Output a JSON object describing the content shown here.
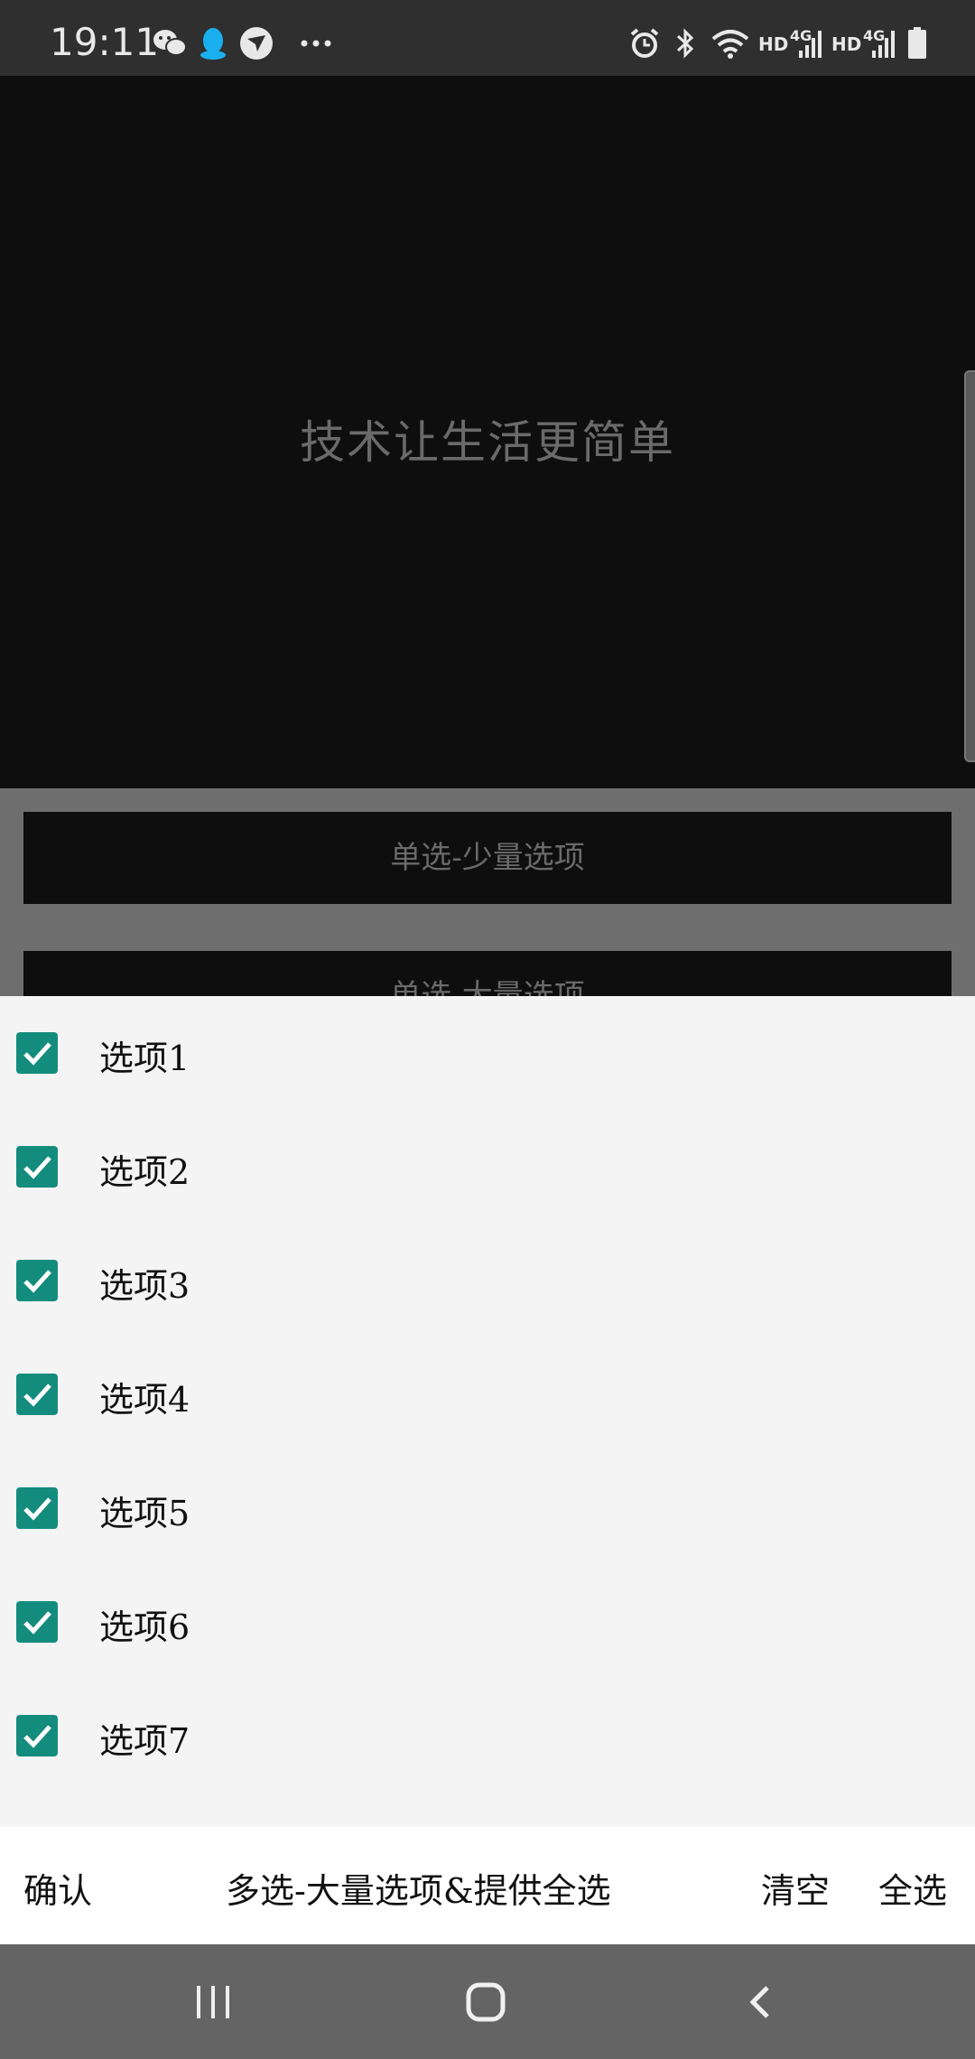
{
  "status_bar": {
    "time": "19:11",
    "icons_left": [
      "wechat-icon",
      "qq-icon",
      "app-icon",
      "more-icon"
    ],
    "icons_right": [
      "alarm-icon",
      "bluetooth-icon",
      "wifi-icon",
      "signal-icon",
      "signal-icon",
      "battery-icon"
    ],
    "hd1": "HD",
    "net1": "4G",
    "hd2": "HD",
    "net2": "4G"
  },
  "page": {
    "hero_text": "技术让生活更简单",
    "buttons": [
      {
        "label": "单选-少量选项"
      },
      {
        "label": "单选-大量选项"
      }
    ]
  },
  "sheet": {
    "options": [
      {
        "label": "选项1",
        "checked": true
      },
      {
        "label": "选项2",
        "checked": true
      },
      {
        "label": "选项3",
        "checked": true
      },
      {
        "label": "选项4",
        "checked": true
      },
      {
        "label": "选项5",
        "checked": true
      },
      {
        "label": "选项6",
        "checked": true
      },
      {
        "label": "选项7",
        "checked": true
      }
    ],
    "confirm_label": "确认",
    "title": "多选-大量选项&提供全选",
    "clear_label": "清空",
    "select_all_label": "全选",
    "checkbox_color": "#148c7d"
  },
  "nav_bar": {
    "icons": [
      "recent-apps-icon",
      "home-icon",
      "back-icon"
    ]
  }
}
